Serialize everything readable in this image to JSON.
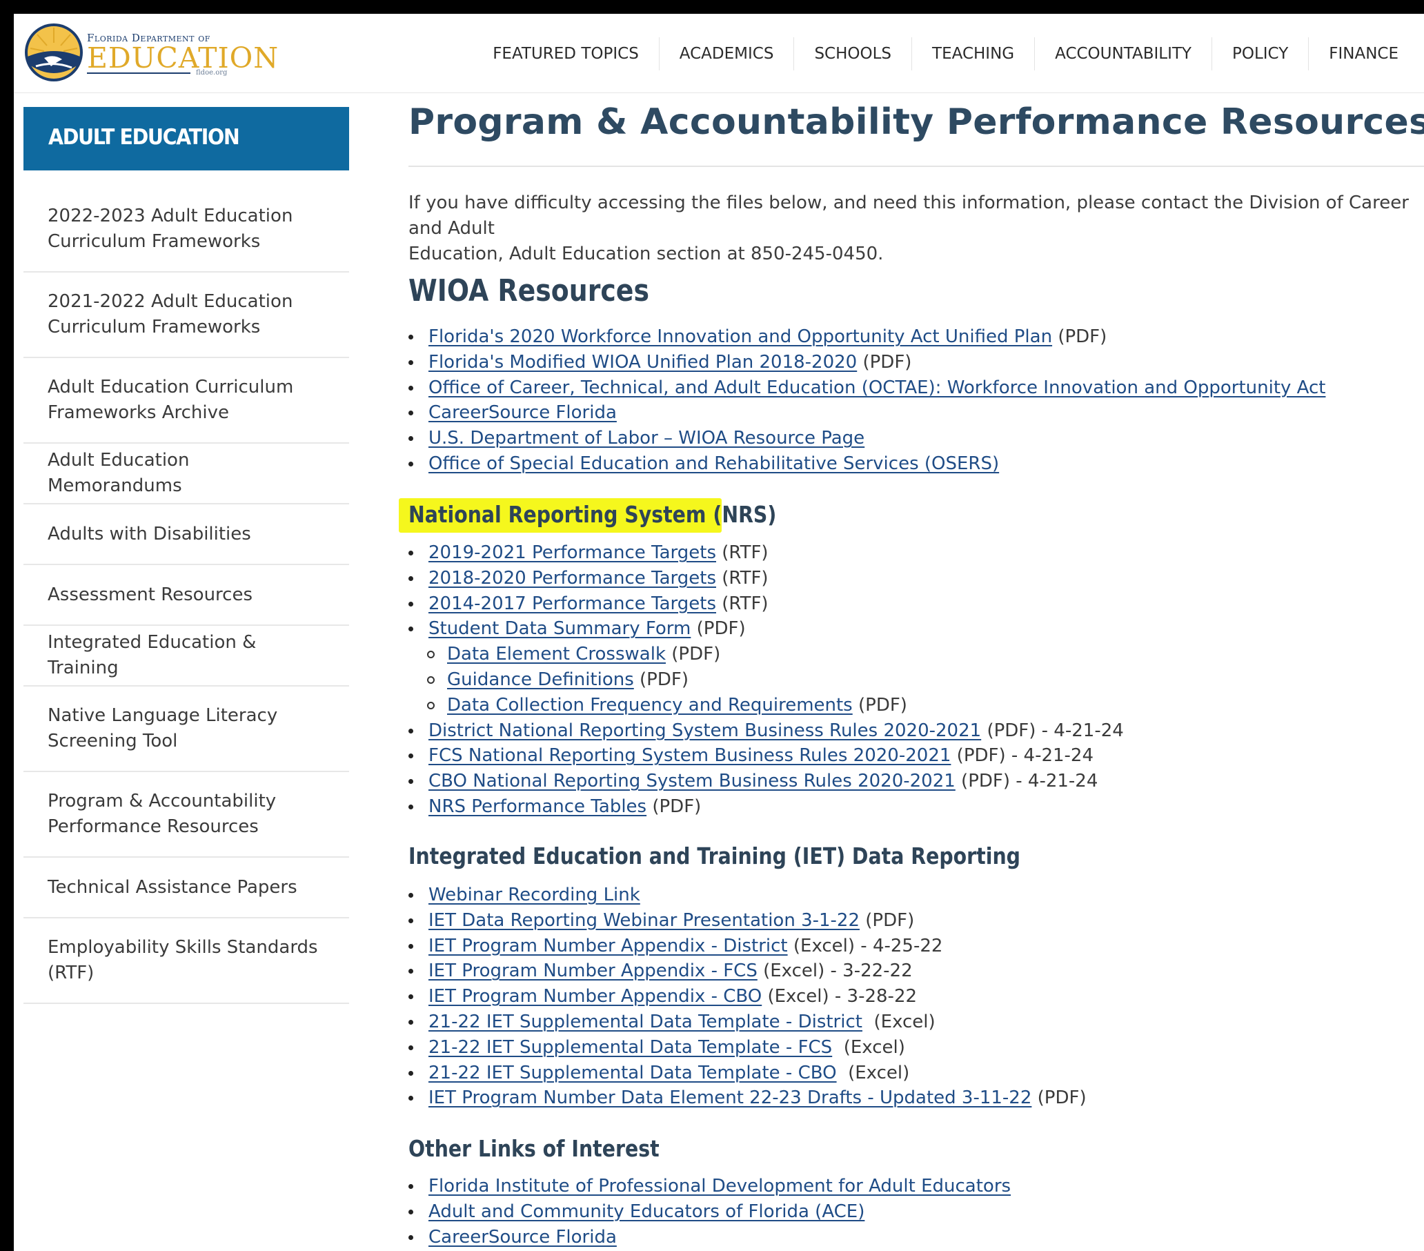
{
  "header": {
    "logo": {
      "line1": "Florida Department of",
      "line2": "EDUCATION",
      "line3": "fldoe.org"
    },
    "nav": [
      "FEATURED TOPICS",
      "ACADEMICS",
      "SCHOOLS",
      "TEACHING",
      "ACCOUNTABILITY",
      "POLICY",
      "FINANCE"
    ]
  },
  "sidebar": {
    "title": "ADULT EDUCATION",
    "items": [
      {
        "label": "2022-2023 Adult Education Curriculum Frameworks",
        "lines": [
          "2022-2023 Adult Education",
          "Curriculum Frameworks"
        ]
      },
      {
        "label": "2021-2022 Adult Education Curriculum Frameworks",
        "lines": [
          "2021-2022 Adult Education",
          "Curriculum Frameworks"
        ]
      },
      {
        "label": "Adult Education Curriculum Frameworks Archive",
        "lines": [
          "Adult Education Curriculum",
          "Frameworks Archive"
        ]
      },
      {
        "label": "Adult Education Memorandums",
        "lines": [
          "Adult Education Memorandums"
        ]
      },
      {
        "label": "Adults with Disabilities",
        "lines": [
          "Adults with Disabilities"
        ]
      },
      {
        "label": "Assessment Resources",
        "lines": [
          "Assessment Resources"
        ]
      },
      {
        "label": "Integrated Education & Training",
        "lines": [
          "Integrated Education & Training"
        ]
      },
      {
        "label": "Native Language Literacy Screening Tool",
        "lines": [
          "Native Language Literacy",
          "Screening Tool"
        ]
      },
      {
        "label": "Program & Accountability Performance Resources",
        "lines": [
          "Program & Accountability",
          "Performance Resources"
        ]
      },
      {
        "label": "Technical Assistance Papers",
        "lines": [
          "Technical Assistance Papers"
        ]
      },
      {
        "label": "Employability Skills Standards (RTF)",
        "lines": [
          "Employability Skills Standards",
          "(RTF)"
        ]
      }
    ]
  },
  "main": {
    "title": "Program & Accountability Performance Resources",
    "intro_line1": "If you have difficulty accessing the files below, and need this information, please contact the Division of Career and Adult",
    "intro_line2": "Education, Adult Education section at 850-245-0450.",
    "wioa": {
      "heading": "WIOA Resources",
      "links": [
        {
          "text": "Florida's 2020 Workforce Innovation and Opportunity Act Unified Plan",
          "suffix": " (PDF)"
        },
        {
          "text": "Florida's Modified WIOA Unified Plan 2018-2020",
          "suffix": " (PDF)"
        },
        {
          "text": "Office of Career, Technical, and Adult Education (OCTAE): Workforce Innovation and Opportunity Act",
          "suffix": ""
        },
        {
          "text": "CareerSource Florida",
          "suffix": ""
        },
        {
          "text": "U.S. Department of Labor – WIOA Resource Page",
          "suffix": ""
        },
        {
          "text": "Office of Special Education and Rehabilitative Services (OSERS)",
          "suffix": ""
        }
      ]
    },
    "nrs": {
      "heading": "National Reporting System (NRS)",
      "links": [
        {
          "text": "2019-2021 Performance Targets",
          "suffix": " (RTF)",
          "sub": false
        },
        {
          "text": "2018-2020 Performance Targets",
          "suffix": " (RTF)",
          "sub": false
        },
        {
          "text": "2014-2017 Performance Targets",
          "suffix": " (RTF)",
          "sub": false
        },
        {
          "text": "Student Data Summary Form",
          "suffix": " (PDF)",
          "sub": false
        },
        {
          "text": "Data Element Crosswalk",
          "suffix": " (PDF)",
          "sub": true
        },
        {
          "text": "Guidance Definitions",
          "suffix": " (PDF)",
          "sub": true
        },
        {
          "text": "Data Collection Frequency and Requirements",
          "suffix": " (PDF)",
          "sub": true
        },
        {
          "text": "District National Reporting System Business Rules 2020-2021",
          "suffix": " (PDF) - 4-21-24",
          "sub": false
        },
        {
          "text": "FCS National Reporting System Business Rules 2020-2021",
          "suffix": " (PDF) - 4-21-24",
          "sub": false
        },
        {
          "text": "CBO National Reporting System Business Rules 2020-2021",
          "suffix": " (PDF) - 4-21-24",
          "sub": false
        },
        {
          "text": "NRS Performance Tables",
          "suffix": " (PDF)",
          "sub": false
        }
      ]
    },
    "iet": {
      "heading": "Integrated Education and Training (IET) Data Reporting",
      "links": [
        {
          "text": "Webinar Recording Link",
          "suffix": ""
        },
        {
          "text": "IET Data Reporting Webinar Presentation 3-1-22",
          "suffix": " (PDF)"
        },
        {
          "text": "IET Program Number Appendix - District",
          "suffix": " (Excel) - 4-25-22"
        },
        {
          "text": "IET Program Number Appendix - FCS",
          "suffix": " (Excel) - 3-22-22"
        },
        {
          "text": "IET Program Number Appendix - CBO",
          "suffix": " (Excel) - 3-28-22"
        },
        {
          "text": "21-22 IET Supplemental Data Template - District",
          "suffix": "  (Excel)"
        },
        {
          "text": "21-22 IET Supplemental Data Template - FCS",
          "suffix": "  (Excel)"
        },
        {
          "text": "21-22 IET Supplemental Data Template - CBO",
          "suffix": "  (Excel)"
        },
        {
          "text": "IET Program Number Data Element 22-23 Drafts - Updated 3-11-22",
          "suffix": " (PDF)"
        }
      ]
    },
    "other": {
      "heading": "Other Links of Interest",
      "links": [
        {
          "text": "Florida Institute of Professional Development for Adult Educators",
          "suffix": ""
        },
        {
          "text": "Adult and Community Educators of Florida (ACE)",
          "suffix": ""
        },
        {
          "text": "CareerSource Florida",
          "suffix": ""
        }
      ]
    }
  },
  "colors": {
    "sidebar_title_bg": "#0f6aa0",
    "link": "#1f4c86",
    "heading": "#2e4458",
    "highlight": "#f5f71d",
    "logo_gold": "#e0a929",
    "logo_navy": "#1c3d6e"
  }
}
